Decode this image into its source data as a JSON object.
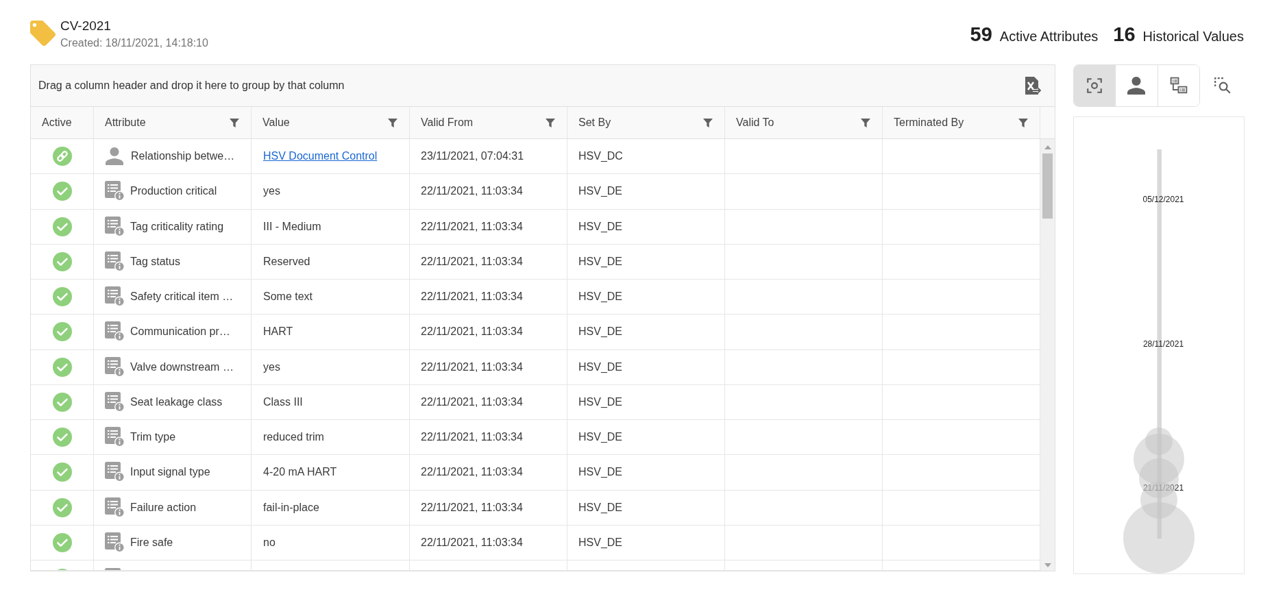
{
  "header": {
    "title": "CV-2021",
    "created": "Created: 18/11/2021, 14:18:10"
  },
  "stats": [
    {
      "count": "59",
      "label": "Active Attributes"
    },
    {
      "count": "16",
      "label": "Historical Values"
    }
  ],
  "grid": {
    "group_panel_hint": "Drag a column header and drop it here to group by that column",
    "columns": [
      {
        "label": "Active",
        "filter": false
      },
      {
        "label": "Attribute",
        "filter": true
      },
      {
        "label": "Value",
        "filter": true
      },
      {
        "label": "Valid From",
        "filter": true
      },
      {
        "label": "Set By",
        "filter": true
      },
      {
        "label": "Valid To",
        "filter": true
      },
      {
        "label": "Terminated By",
        "filter": true
      }
    ],
    "rows": [
      {
        "kind": "relationship",
        "active": true,
        "attribute": "Relationship betwe…",
        "value": "HSV Document Control",
        "valid_from": "23/11/2021, 07:04:31",
        "set_by": "HSV_DC"
      },
      {
        "kind": "attribute",
        "active": true,
        "attribute": "Production critical",
        "value": "yes",
        "valid_from": "22/11/2021, 11:03:34",
        "set_by": "HSV_DE"
      },
      {
        "kind": "attribute",
        "active": true,
        "attribute": "Tag criticality rating",
        "value": "III - Medium",
        "valid_from": "22/11/2021, 11:03:34",
        "set_by": "HSV_DE"
      },
      {
        "kind": "attribute",
        "active": true,
        "attribute": "Tag status",
        "value": "Reserved",
        "valid_from": "22/11/2021, 11:03:34",
        "set_by": "HSV_DE"
      },
      {
        "kind": "attribute",
        "active": true,
        "attribute": "Safety critical item …",
        "value": "Some text",
        "valid_from": "22/11/2021, 11:03:34",
        "set_by": "HSV_DE"
      },
      {
        "kind": "attribute",
        "active": true,
        "attribute": "Communication pr…",
        "value": "HART",
        "valid_from": "22/11/2021, 11:03:34",
        "set_by": "HSV_DE"
      },
      {
        "kind": "attribute",
        "active": true,
        "attribute": "Valve downstream …",
        "value": "yes",
        "valid_from": "22/11/2021, 11:03:34",
        "set_by": "HSV_DE"
      },
      {
        "kind": "attribute",
        "active": true,
        "attribute": "Seat leakage class",
        "value": "Class III",
        "valid_from": "22/11/2021, 11:03:34",
        "set_by": "HSV_DE"
      },
      {
        "kind": "attribute",
        "active": true,
        "attribute": "Trim type",
        "value": "reduced trim",
        "valid_from": "22/11/2021, 11:03:34",
        "set_by": "HSV_DE"
      },
      {
        "kind": "attribute",
        "active": true,
        "attribute": "Input signal type",
        "value": "4-20 mA HART",
        "valid_from": "22/11/2021, 11:03:34",
        "set_by": "HSV_DE"
      },
      {
        "kind": "attribute",
        "active": true,
        "attribute": "Failure action",
        "value": "fail-in-place",
        "valid_from": "22/11/2021, 11:03:34",
        "set_by": "HSV_DE"
      },
      {
        "kind": "attribute",
        "active": true,
        "attribute": "Fire safe",
        "value": "no",
        "valid_from": "22/11/2021, 11:03:34",
        "set_by": "HSV_DE"
      },
      {
        "kind": "attribute",
        "active": true
      }
    ]
  },
  "view_buttons": [
    {
      "kind": "focus",
      "selected": true
    },
    {
      "kind": "person",
      "selected": false
    },
    {
      "kind": "hierarchy",
      "selected": false
    }
  ],
  "timeline": {
    "date_labels": [
      "05/12/2021",
      "28/11/2021",
      "21/11/2021"
    ]
  }
}
